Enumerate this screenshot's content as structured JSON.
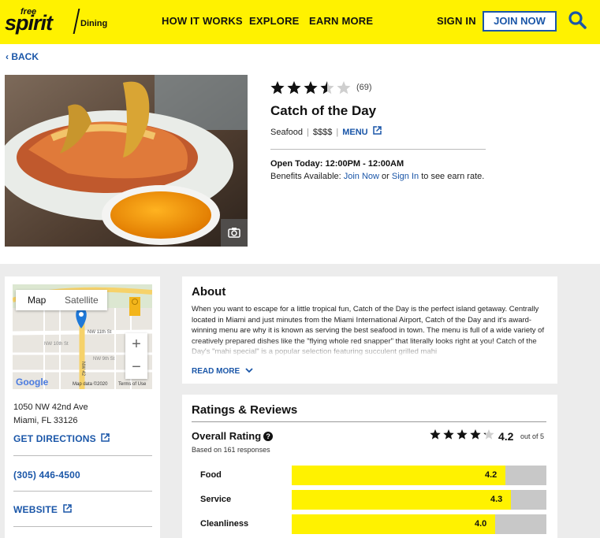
{
  "header": {
    "logo_free": "free",
    "logo_spirit": "spirit",
    "logo_dining": "Dining",
    "nav": [
      "HOW IT WORKS",
      "EXPLORE",
      "EARN MORE"
    ],
    "sign_in": "SIGN IN",
    "join_now": "JOIN NOW",
    "search_icon": "search-icon"
  },
  "back_label": "BACK",
  "restaurant": {
    "rating": 3.5,
    "review_count": "(69)",
    "name": "Catch of the Day",
    "cuisine": "Seafood",
    "price": "$$$$",
    "menu_label": "MENU",
    "hours": "Open Today: 12:00PM - 12:00AM",
    "benefits_prefix": "Benefits Available: ",
    "benefits_join": "Join Now",
    "benefits_or": " or ",
    "benefits_signin": "Sign In",
    "benefits_suffix": " to see earn rate."
  },
  "map": {
    "tab_map": "Map",
    "tab_satellite": "Satellite",
    "street_1": "NW 11th St",
    "street_2": "NW 10th St",
    "street_3": "NW 9th St",
    "avenue": "NW 42",
    "logo": "Google",
    "map_data": "Map data ©2020",
    "terms": "Terms of Use"
  },
  "location": {
    "address_line1": "1050 NW 42nd Ave",
    "address_line2": "Miami, FL 33126",
    "directions": "GET DIRECTIONS",
    "phone": "(305) 446-4500",
    "website": "WEBSITE"
  },
  "about": {
    "heading": "About",
    "text": "When you want to escape for a little tropical fun, Catch of the Day is the perfect island getaway. Centrally located in Miami and just minutes from the Miami International Airport, Catch of the Day and it's award-winning menu are why it is known as serving the best seafood in town. The menu is full of a wide variety of creatively prepared dishes like the \"flying whole red snapper\" that literally looks right at you! Catch of the Day's \"mahi special\" is a popular selection featuring succulent grilled mahi",
    "read_more": "READ MORE"
  },
  "ratings": {
    "heading": "Ratings & Reviews",
    "overall_label": "Overall Rating",
    "based_on": "Based on 161 responses",
    "overall_value": "4.2",
    "overall_stars": 4.2,
    "out_of": "out of 5",
    "categories": [
      {
        "label": "Food",
        "value": "4.2",
        "fraction": 0.84
      },
      {
        "label": "Service",
        "value": "4.3",
        "fraction": 0.86
      },
      {
        "label": "Cleanliness",
        "value": "4.0",
        "fraction": 0.8
      }
    ]
  },
  "colors": {
    "brand_yellow": "#fff200",
    "link_blue": "#1a56a8",
    "bar_track": "#c8c8c8"
  }
}
